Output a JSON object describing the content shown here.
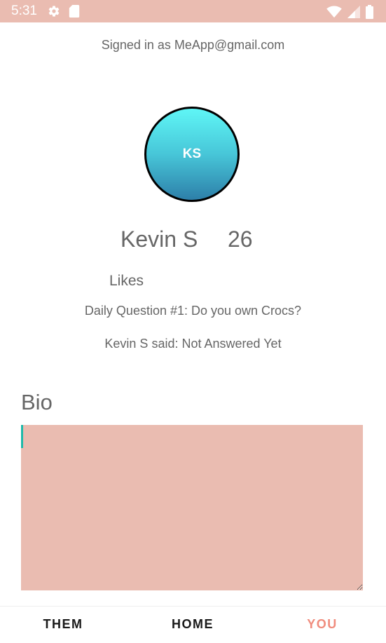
{
  "status_bar": {
    "time": "5:31",
    "color": "#eabcb1",
    "left_icons": [
      "gear-icon",
      "sd-card-icon"
    ],
    "right_icons": [
      "wifi-icon",
      "signal-icon",
      "battery-icon"
    ]
  },
  "header": {
    "signed_in_text": "Signed in as MeApp@gmail.com"
  },
  "profile": {
    "avatar_initials": "KS",
    "name": "Kevin S",
    "age": "26",
    "likes_label": "Likes",
    "daily_question": "Daily Question #1: Do you own Crocs?",
    "daily_answer": "Kevin S said: Not Answered Yet"
  },
  "bio": {
    "heading": "Bio",
    "value": ""
  },
  "bottom_nav": {
    "tabs": [
      {
        "label": "THEM",
        "active": false
      },
      {
        "label": "HOME",
        "active": false
      },
      {
        "label": "YOU",
        "active": true
      }
    ],
    "active_color": "#f08c7d"
  }
}
